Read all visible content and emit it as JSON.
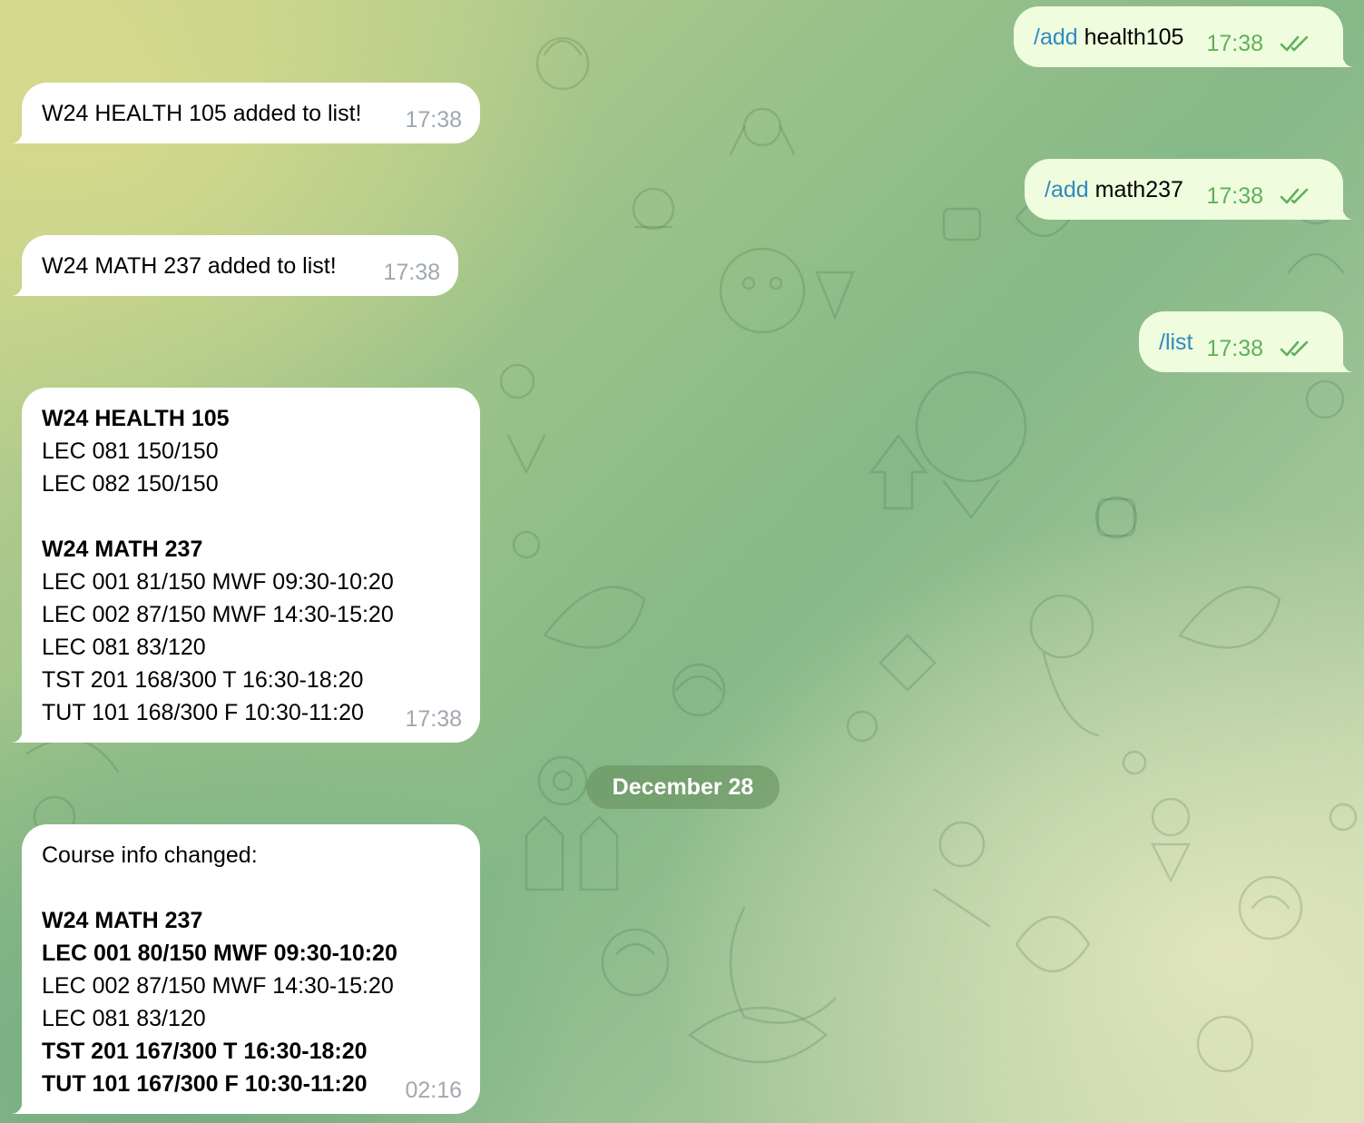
{
  "colors": {
    "incoming_bubble": "#ffffff",
    "outgoing_bubble": "#effdde",
    "command_link": "#2f8ac3",
    "time_out": "#5fb05a",
    "time_in": "#a0a8b0"
  },
  "messages": {
    "m1": {
      "cmd": "/add",
      "arg": " health105",
      "time": "17:38",
      "status": "read-double-check-icon"
    },
    "m2": {
      "text": "W24 HEALTH 105 added to list!",
      "time": "17:38"
    },
    "m3": {
      "cmd": "/add",
      "arg": " math237",
      "time": "17:38",
      "status": "read-double-check-icon"
    },
    "m4": {
      "text": "W24 MATH 237 added to list!",
      "time": "17:38"
    },
    "m5": {
      "cmd": "/list",
      "time": "17:38",
      "status": "read-double-check-icon"
    },
    "m6": {
      "time": "17:38",
      "lines": [
        "W24 HEALTH 105",
        "LEC 081 150/150",
        "LEC 082 150/150",
        "",
        "W24 MATH 237",
        "LEC 001 81/150 MWF 09:30-10:20",
        "LEC 002 87/150 MWF 14:30-15:20",
        "LEC 081 83/120",
        "TST 201 168/300 T 16:30-18:20",
        "TUT 101 168/300 F 10:30-11:20"
      ]
    },
    "date_separator": "December 28",
    "m7": {
      "time": "02:16",
      "lines": [
        "Course info changed:",
        "",
        "W24 MATH 237",
        "LEC 001 80/150 MWF 09:30-10:20",
        "LEC 002 87/150 MWF 14:30-15:20",
        "LEC 081 83/120",
        "TST 201 167/300 T 16:30-18:20",
        "TUT 101 167/300 F 10:30-11:20"
      ]
    }
  }
}
